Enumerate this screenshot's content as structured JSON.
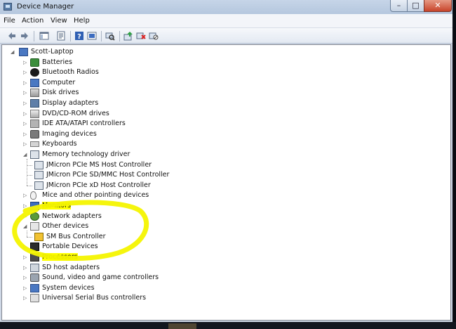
{
  "window": {
    "title": "Device Manager"
  },
  "menubar": {
    "items": [
      "File",
      "Action",
      "View",
      "Help"
    ]
  },
  "toolbar": {
    "icons": [
      "back-arrow-icon",
      "forward-arrow-icon",
      "show-hide-console-tree-icon",
      "properties-icon",
      "help-icon",
      "show-device-icon",
      "scan-hardware-icon",
      "update-driver-icon",
      "uninstall-icon",
      "disable-icon"
    ]
  },
  "tree": {
    "root": "Scott-Laptop",
    "nodes": [
      {
        "label": "Batteries",
        "icon": "battery-icon",
        "expanded": false
      },
      {
        "label": "Bluetooth Radios",
        "icon": "bluetooth-icon",
        "expanded": false
      },
      {
        "label": "Computer",
        "icon": "computer-icon",
        "expanded": false
      },
      {
        "label": "Disk drives",
        "icon": "disk-drive-icon",
        "expanded": false
      },
      {
        "label": "Display adapters",
        "icon": "display-adapter-icon",
        "expanded": false
      },
      {
        "label": "DVD/CD-ROM drives",
        "icon": "dvd-drive-icon",
        "expanded": false
      },
      {
        "label": "IDE ATA/ATAPI controllers",
        "icon": "ide-controller-icon",
        "expanded": false
      },
      {
        "label": "Imaging devices",
        "icon": "camera-icon",
        "expanded": false
      },
      {
        "label": "Keyboards",
        "icon": "keyboard-icon",
        "expanded": false
      },
      {
        "label": "Memory technology driver",
        "icon": "memory-controller-icon",
        "expanded": true,
        "children": [
          {
            "label": "JMicron PCIe MS Host Controller",
            "icon": "memory-controller-icon"
          },
          {
            "label": "JMicron PCIe SD/MMC Host Controller",
            "icon": "memory-controller-icon"
          },
          {
            "label": "JMicron PCIe xD Host Controller",
            "icon": "memory-controller-icon"
          }
        ]
      },
      {
        "label": "Mice and other pointing devices",
        "icon": "mouse-icon",
        "expanded": false
      },
      {
        "label": "Monitors",
        "icon": "monitor-icon",
        "expanded": false,
        "highlight": true
      },
      {
        "label": "Network adapters",
        "icon": "network-adapter-icon",
        "expanded": false
      },
      {
        "label": "Other devices",
        "icon": "unknown-device-icon",
        "expanded": true,
        "children": [
          {
            "label": "SM Bus Controller",
            "icon": "warning-device-icon"
          }
        ]
      },
      {
        "label": "Portable Devices",
        "icon": "portable-device-icon",
        "expanded": false
      },
      {
        "label": "Processors",
        "icon": "processor-icon",
        "expanded": false,
        "highlight": true
      },
      {
        "label": "SD host adapters",
        "icon": "sd-host-icon",
        "expanded": false
      },
      {
        "label": "Sound, video and game controllers",
        "icon": "speaker-icon",
        "expanded": false
      },
      {
        "label": "System devices",
        "icon": "system-device-icon",
        "expanded": false
      },
      {
        "label": "Universal Serial Bus controllers",
        "icon": "usb-icon",
        "expanded": false
      }
    ]
  },
  "colors": {
    "highlight": "#ffff00",
    "annotation_circle": "#f4f400",
    "title_bar": "#b9cbe0",
    "close_button": "#c7442a"
  }
}
